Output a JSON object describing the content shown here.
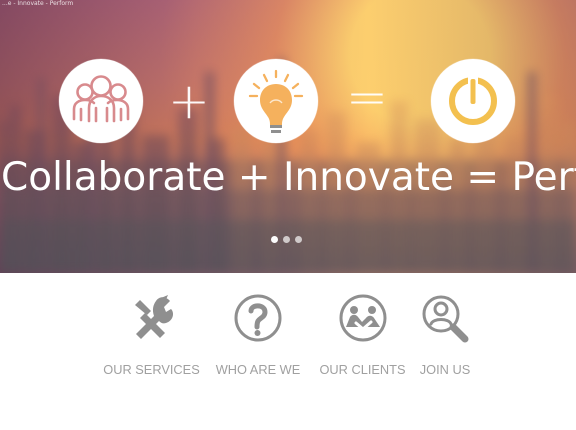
{
  "page": {
    "topbar_text": "...e - Innovate - Perform"
  },
  "hero": {
    "tagline": "Collaborate + Innovate = Perform",
    "operators": {
      "plus": "+",
      "equals": "="
    },
    "icons": {
      "collaborate": "people-icon",
      "innovate": "lightbulb-icon",
      "perform": "power-icon"
    },
    "colors": {
      "icon_accent": "#d88a8d",
      "bulb_accent": "#f5b15d",
      "power_accent": "#f3c04f",
      "white": "#ffffff"
    }
  },
  "carousel": {
    "slides": 3,
    "active_slide": 1
  },
  "navigation": {
    "items": [
      {
        "label": "OUR SERVICES",
        "icon": "tools-icon"
      },
      {
        "label": "WHO ARE WE",
        "icon": "question-circle-icon"
      },
      {
        "label": "OUR CLIENTS",
        "icon": "handshake-icon"
      },
      {
        "label": "JOIN US",
        "icon": "magnifier-user-icon"
      }
    ],
    "colors": {
      "icon_gray": "#8f8f8f",
      "label_gray": "#a0a0a0"
    }
  }
}
